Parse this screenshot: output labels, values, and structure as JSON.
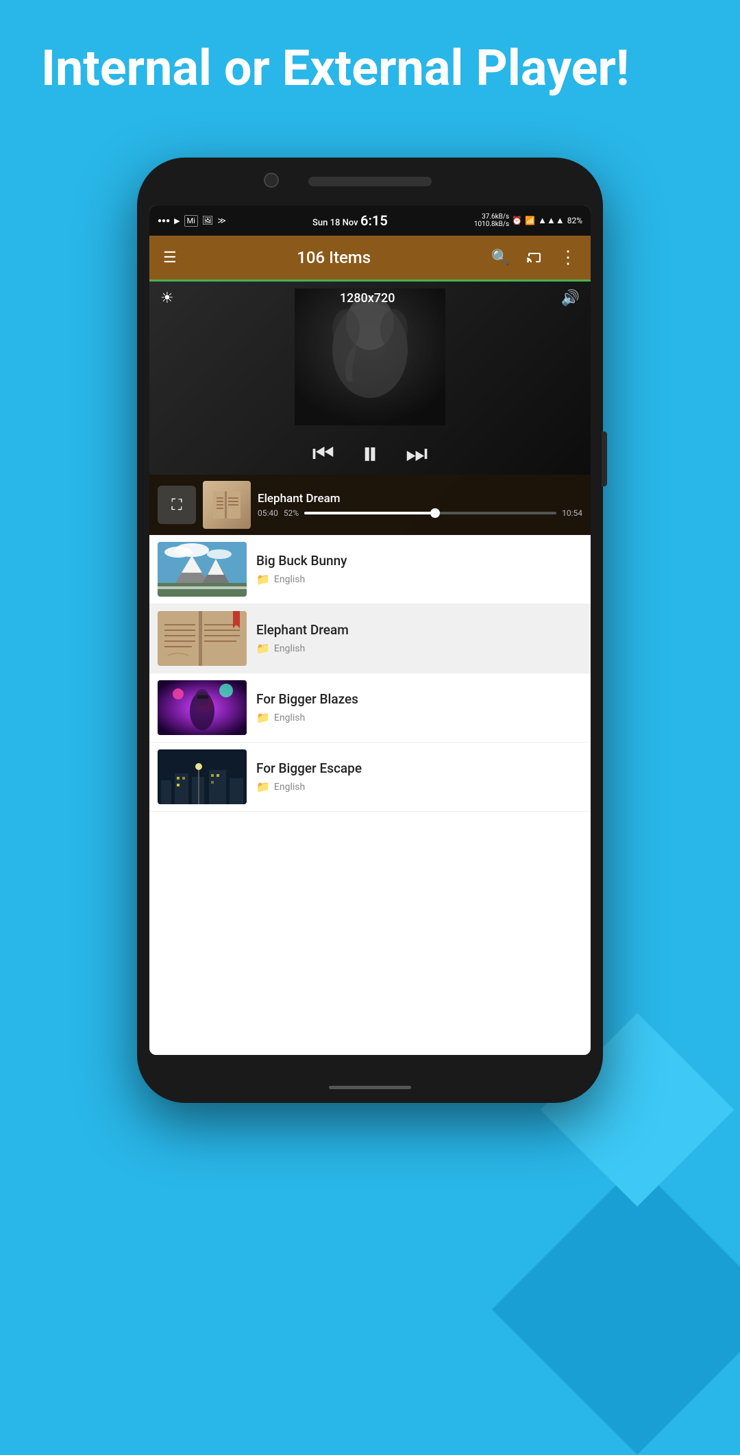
{
  "page": {
    "title": "Internal or External Player!",
    "background_color": "#29b6e8"
  },
  "status_bar": {
    "notifications": "●●●",
    "play_icon": "▶",
    "date": "Sun 18 Nov",
    "time": "6:15",
    "speed_top": "37.6kB/s",
    "speed_bottom": "1010.8kB/s",
    "battery": "82%",
    "signal": "▲▲▲▲"
  },
  "toolbar": {
    "menu_icon": "☰",
    "title": "106 Items",
    "search_icon": "🔍",
    "cast_icon": "⬗",
    "more_icon": "⋮"
  },
  "player": {
    "resolution": "1280x720",
    "brightness_icon": "☀",
    "volume_icon": "🔊",
    "rewind_icon": "◀◀",
    "pause_icon": "⏸",
    "forward_icon": "▶▶",
    "fullscreen_icon": "⛶",
    "current_time": "05:40",
    "progress_percent": "52%",
    "total_time": "10:54",
    "now_playing_title": "Elephant Dream"
  },
  "video_list": {
    "items": [
      {
        "id": 1,
        "title": "Big Buck Bunny",
        "folder": "English",
        "thumb_type": "mountain"
      },
      {
        "id": 2,
        "title": "Elephant Dream",
        "folder": "English",
        "thumb_type": "book",
        "selected": true
      },
      {
        "id": 3,
        "title": "For Bigger Blazes",
        "folder": "English",
        "thumb_type": "neon"
      },
      {
        "id": 4,
        "title": "For Bigger Escape",
        "folder": "English",
        "thumb_type": "dark"
      }
    ]
  }
}
